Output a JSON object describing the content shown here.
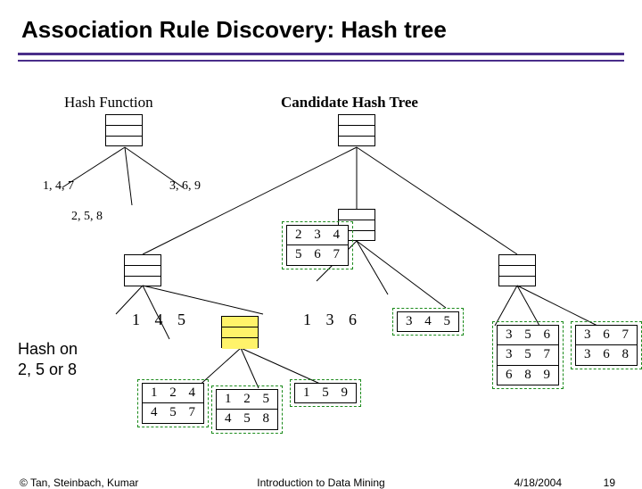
{
  "title": "Association Rule Discovery: Hash tree",
  "labels": {
    "hash_function": "Hash Function",
    "candidate": "Candidate Hash Tree",
    "b147": "1, 4, 7",
    "b369": "3, 6, 9",
    "b258": "2, 5, 8",
    "n145": "1 4 5",
    "n136": "1 3 6",
    "hashon_l1": "Hash on",
    "hashon_l2": "2, 5 or 8"
  },
  "leaves": {
    "a1": "2 3 4",
    "a2": "5 6 7",
    "b1": "1 2 4",
    "b2": "4 5 7",
    "c1": "1 2 5",
    "c2": "4 5 8",
    "d1": "1 5 9",
    "e1": "3 4 5",
    "f1": "3 5 6",
    "f2": "3 5 7",
    "f3": "6 8 9",
    "g1": "3 6 7",
    "g2": "3 6 8"
  },
  "footer": {
    "copy": "© Tan, Steinbach, Kumar",
    "mid": "Introduction to Data Mining",
    "date": "4/18/2004",
    "page": "19"
  }
}
